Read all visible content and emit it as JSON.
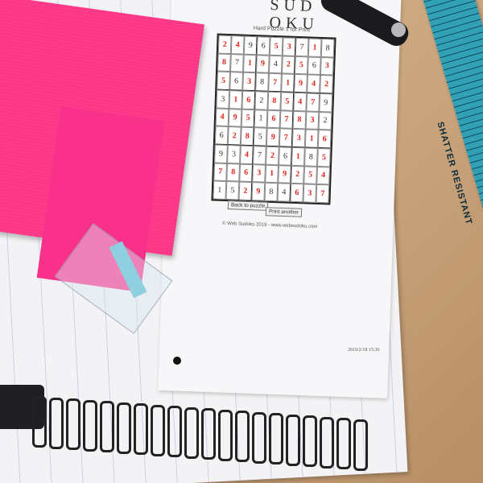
{
  "scene": {
    "description_keys": [
      "notebook",
      "sudoku-sheet",
      "pink-sticky-notes",
      "ruler",
      "pen"
    ]
  },
  "sudoku": {
    "logo_line1": "SUD",
    "logo_line2": "OKU",
    "caption": "Hard Puzzle 1 for Print",
    "grid": [
      [
        "2",
        "4",
        "9",
        "6",
        "5",
        "3",
        "7",
        "1",
        "8"
      ],
      [
        "8",
        "7",
        "1",
        "9",
        "4",
        "2",
        "5",
        "6",
        "3"
      ],
      [
        "5",
        "6",
        "3",
        "8",
        "7",
        "1",
        "9",
        "4",
        "2"
      ],
      [
        "3",
        "1",
        "6",
        "2",
        "8",
        "5",
        "4",
        "7",
        "9"
      ],
      [
        "4",
        "9",
        "5",
        "1",
        "6",
        "7",
        "8",
        "3",
        "2"
      ],
      [
        "6",
        "2",
        "8",
        "5",
        "9",
        "7",
        "3",
        "1",
        "6"
      ],
      [
        "9",
        "3",
        "4",
        "7",
        "2",
        "6",
        "1",
        "8",
        "5"
      ],
      [
        "7",
        "8",
        "6",
        "3",
        "1",
        "9",
        "2",
        "5",
        "4"
      ],
      [
        "1",
        "5",
        "2",
        "9",
        "8",
        "4",
        "6",
        "3",
        "7"
      ]
    ],
    "given_mask": [
      [
        0,
        0,
        1,
        1,
        0,
        0,
        1,
        0,
        1
      ],
      [
        0,
        1,
        0,
        0,
        1,
        0,
        0,
        1,
        0
      ],
      [
        0,
        1,
        0,
        1,
        0,
        0,
        0,
        0,
        0
      ],
      [
        1,
        0,
        0,
        1,
        0,
        0,
        0,
        0,
        1
      ],
      [
        0,
        0,
        0,
        1,
        0,
        0,
        0,
        0,
        1
      ],
      [
        1,
        0,
        0,
        1,
        0,
        0,
        0,
        0,
        0
      ],
      [
        1,
        1,
        0,
        1,
        0,
        1,
        0,
        1,
        0
      ],
      [
        0,
        0,
        0,
        0,
        0,
        0,
        0,
        0,
        0
      ],
      [
        1,
        1,
        0,
        0,
        1,
        1,
        0,
        0,
        0
      ]
    ],
    "button_back": "Back to puzzle",
    "button_print": "Print another",
    "footer": "© Web Sudoku 2019 - www.websudoku.com",
    "stamp": "2019/2/18 15:36"
  },
  "ruler": {
    "label": "SHATTER RESISTANT",
    "accent": "#25a0ba"
  },
  "colors": {
    "pink": "#ff3d8e",
    "filled_digit": "#e0281c",
    "wood": "#c9a47c"
  }
}
